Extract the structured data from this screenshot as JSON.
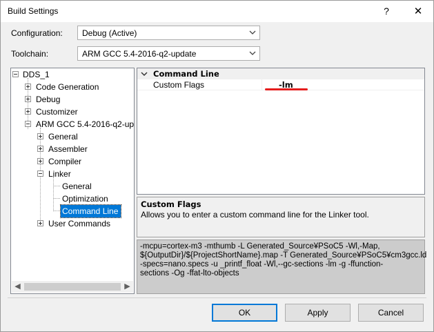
{
  "window": {
    "title": "Build Settings",
    "help_label": "?",
    "close_label": "✕"
  },
  "form": {
    "configuration_label": "Configuration:",
    "configuration_value": "Debug (Active)",
    "toolchain_label": "Toolchain:",
    "toolchain_value": "ARM GCC 5.4-2016-q2-update"
  },
  "tree": {
    "root": "DDS_1",
    "code_generation": "Code Generation",
    "debug": "Debug",
    "customizer": "Customizer",
    "arm_gcc": "ARM GCC 5.4-2016-q2-up",
    "general": "General",
    "assembler": "Assembler",
    "compiler": "Compiler",
    "linker": "Linker",
    "linker_general": "General",
    "linker_optimization": "Optimization",
    "linker_command_line": "Command Line",
    "user_commands": "User Commands"
  },
  "property_grid": {
    "category": "Command Line",
    "rows": [
      {
        "name": "Custom Flags",
        "value": "-lm"
      }
    ]
  },
  "description": {
    "title": "Custom Flags",
    "text": "Allows you to enter a custom command line for the Linker tool."
  },
  "command_preview": {
    "lines": [
      "-mcpu=cortex-m3 -mthumb -L Generated_Source¥PSoC5 -Wl,-Map,",
      "${OutputDir}/${ProjectShortName}.map -T Generated_Source¥PSoC5¥cm3gcc.ld",
      "-specs=nano.specs -u _printf_float -Wl,--gc-sections -lm -g -ffunction-",
      "sections -Og -ffat-lto-objects"
    ]
  },
  "buttons": {
    "ok": "OK",
    "apply": "Apply",
    "cancel": "Cancel"
  },
  "colors": {
    "selection": "#0078d7",
    "annotation_red": "#e51c1c",
    "default_button_border": "#0078d7"
  }
}
